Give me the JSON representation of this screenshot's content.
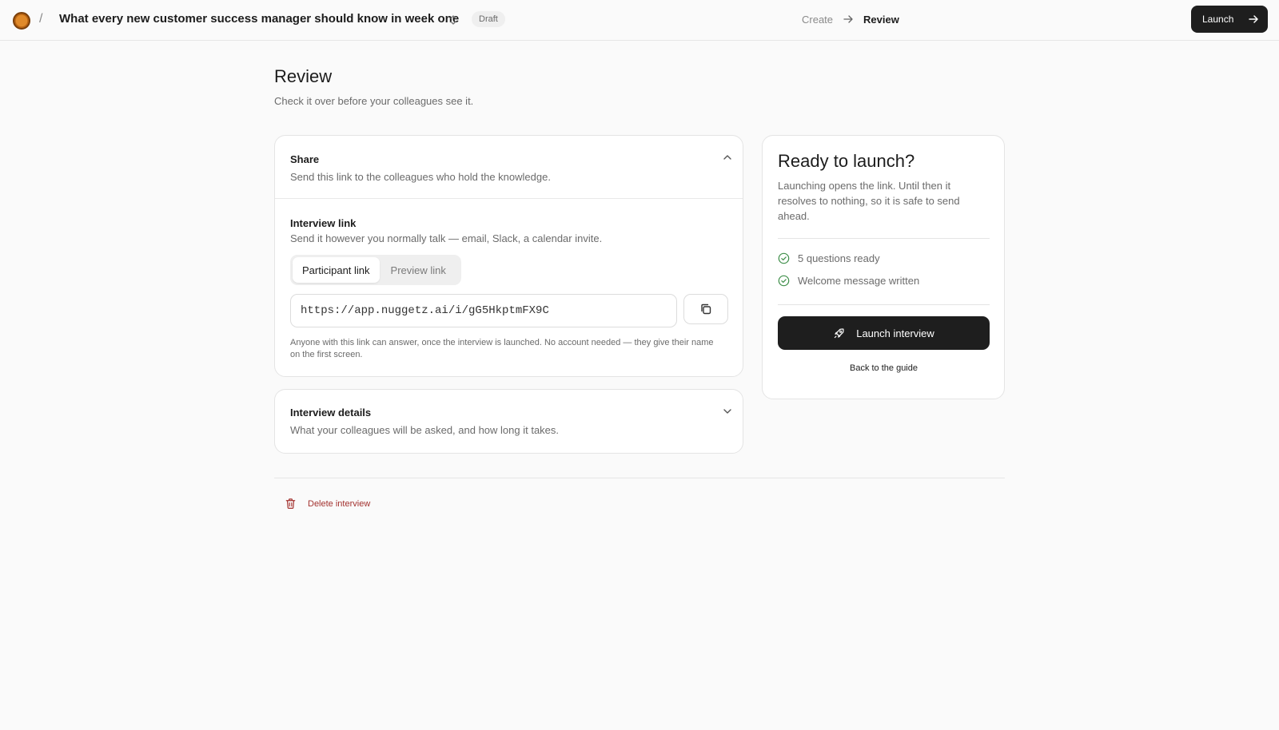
{
  "header": {
    "breadcrumb_separator": "/",
    "doc_title": "What every new customer success manager should know in week one",
    "status_badge": "Draft",
    "steps": {
      "create": "Create",
      "review": "Review"
    },
    "launch_label": "Launch"
  },
  "page": {
    "title": "Review",
    "subtitle": "Check it over before your colleagues see it."
  },
  "share": {
    "title": "Share",
    "subtitle": "Send this link to the colleagues who hold the knowledge.",
    "link_label": "Interview link",
    "link_sub": "Send it however you normally talk — email, Slack, a calendar invite.",
    "tabs": [
      {
        "label": "Participant link",
        "active": true
      },
      {
        "label": "Preview link",
        "active": false
      }
    ],
    "url": "https://app.nuggetz.ai/i/gG5HkptmFX9C",
    "note": "Anyone with this link can answer, once the interview is launched. No account needed — they give their name on the first screen."
  },
  "details": {
    "title": "Interview details",
    "subtitle": "What your colleagues will be asked, and how long it takes."
  },
  "launch_card": {
    "title": "Ready to launch?",
    "description": "Launching opens the link. Until then it resolves to nothing, so it is safe to send ahead.",
    "checks": [
      {
        "label": "5 questions ready",
        "icon": "check-circle-icon"
      },
      {
        "label": "Welcome message written",
        "icon": "check-circle-icon"
      }
    ],
    "launch_label": "Launch interview",
    "back_label": "Back to the guide"
  },
  "footer": {
    "delete_label": "Delete interview"
  },
  "colors": {
    "accent_dark": "#1e1e1e",
    "check_green": "#3f8f4a",
    "danger": "#a3322f",
    "logo_orange": "#e08a2a"
  }
}
